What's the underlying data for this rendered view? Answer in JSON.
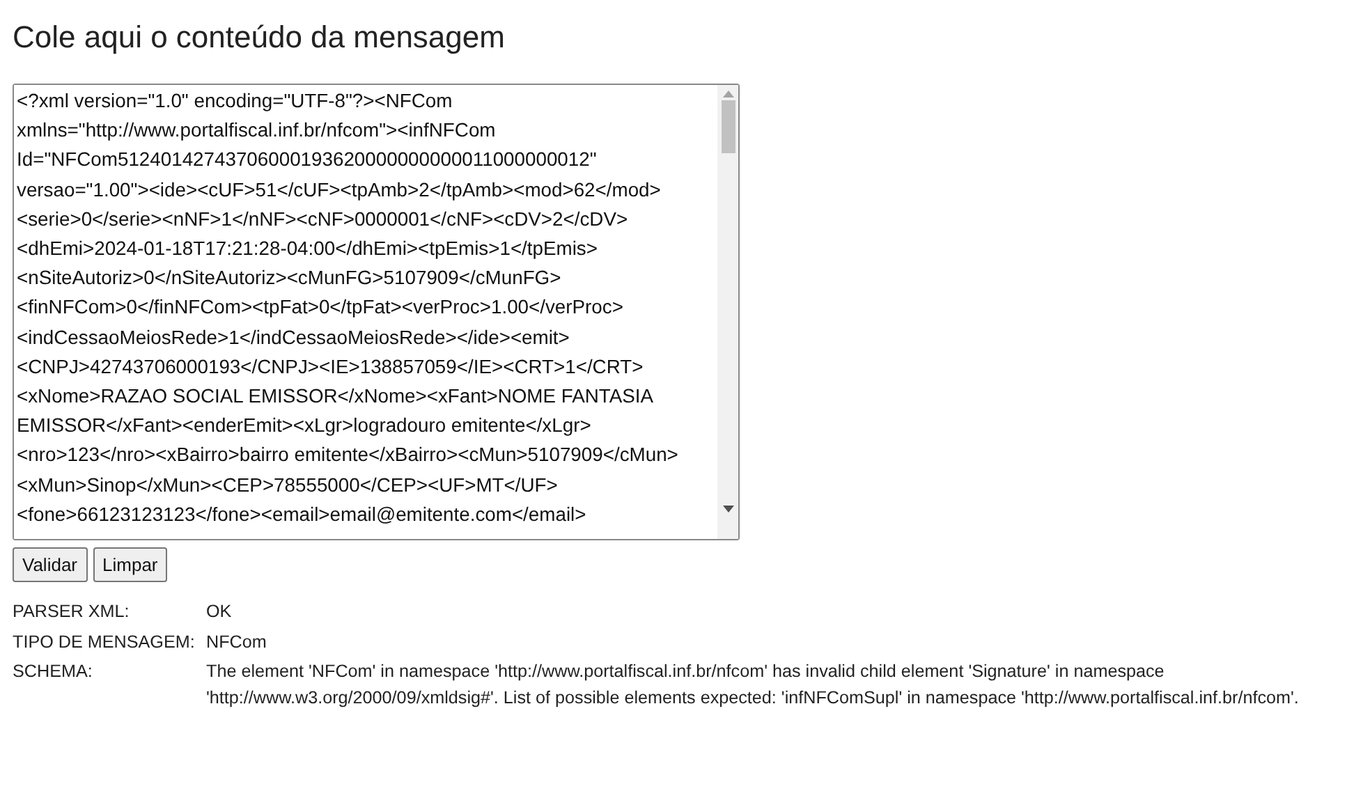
{
  "heading": "Cole aqui o conteúdo da mensagem",
  "message": {
    "value": "<?xml version=\"1.0\" encoding=\"UTF-8\"?><NFCom xmlns=\"http://www.portalfiscal.inf.br/nfcom\"><infNFCom Id=\"NFCom51240142743706000193620000000000011000000012\" versao=\"1.00\"><ide><cUF>51</cUF><tpAmb>2</tpAmb><mod>62</mod><serie>0</serie><nNF>1</nNF><cNF>0000001</cNF><cDV>2</cDV><dhEmi>2024-01-18T17:21:28-04:00</dhEmi><tpEmis>1</tpEmis><nSiteAutoriz>0</nSiteAutoriz><cMunFG>5107909</cMunFG><finNFCom>0</finNFCom><tpFat>0</tpFat><verProc>1.00</verProc><indCessaoMeiosRede>1</indCessaoMeiosRede></ide><emit><CNPJ>42743706000193</CNPJ><IE>138857059</IE><CRT>1</CRT><xNome>RAZAO SOCIAL EMISSOR</xNome><xFant>NOME FANTASIA EMISSOR</xFant><enderEmit><xLgr>logradouro emitente</xLgr><nro>123</nro><xBairro>bairro emitente</xBairro><cMun>5107909</cMun><xMun>Sinop</xMun><CEP>78555000</CEP><UF>MT</UF><fone>66123123123</fone><email>email@emitente.com</email>"
  },
  "buttons": [
    "Validar",
    "Limpar"
  ],
  "results": [
    {
      "label": "PARSER XML:",
      "value": "OK"
    },
    {
      "label": "TIPO DE MENSAGEM:",
      "value": "NFCom"
    },
    {
      "label": "SCHEMA:",
      "value": "The element 'NFCom' in namespace 'http://www.portalfiscal.inf.br/nfcom' has invalid child element 'Signature' in namespace 'http://www.w3.org/2000/09/xmldsig#'. List of possible elements expected: 'infNFComSupl' in namespace 'http://www.portalfiscal.inf.br/nfcom'."
    }
  ]
}
